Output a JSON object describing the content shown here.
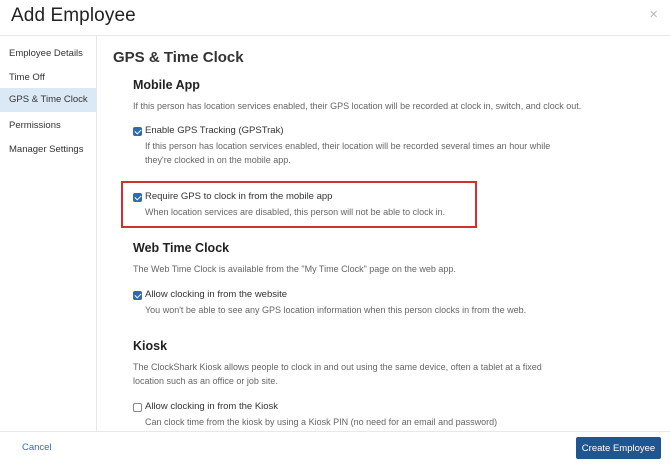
{
  "modal": {
    "title": "Add Employee",
    "close": "×"
  },
  "sidebar": {
    "items": [
      {
        "label": "Employee Details",
        "active": false
      },
      {
        "label": "Time Off",
        "active": false
      },
      {
        "label": "GPS & Time Clock",
        "active": true
      },
      {
        "label": "Permissions",
        "active": false
      },
      {
        "label": "Manager Settings",
        "active": false
      }
    ]
  },
  "main": {
    "section_title": "GPS & Time Clock",
    "mobile_app": {
      "title": "Mobile App",
      "description": "If this person has location services enabled, their GPS location will be recorded at clock in, switch, and clock out.",
      "options": [
        {
          "label": "Enable GPS Tracking (GPSTrak)",
          "description": "If this person has location services enabled, their location will be recorded several times an hour while they're clocked in on the mobile app.",
          "checked": true
        },
        {
          "label": "Require GPS to clock in from the mobile app",
          "description": "When location services are disabled, this person will not be able to clock in.",
          "checked": true
        }
      ]
    },
    "web_time_clock": {
      "title": "Web Time Clock",
      "description": "The Web Time Clock is available from the \"My Time Clock\" page on the web app.",
      "options": [
        {
          "label": "Allow clocking in from the website",
          "description": "You won't be able to see any GPS location information when this person clocks in from the web.",
          "checked": true
        }
      ]
    },
    "kiosk": {
      "title": "Kiosk",
      "description": "The ClockShark Kiosk allows people to clock in and out using the same device, often a tablet at a fixed location such as an office or job site.",
      "options": [
        {
          "label": "Allow clocking in from the Kiosk",
          "description": "Can clock time from the kiosk by using a Kiosk PIN (no need for an email and password)",
          "checked": false
        }
      ]
    }
  },
  "footer": {
    "cancel_label": "Cancel",
    "create_label": "Create Employee"
  },
  "colors": {
    "accent": "#1f5590",
    "link": "#2f6fb3",
    "active_nav": "#dbe9f7",
    "highlight": "#d32f2f"
  }
}
